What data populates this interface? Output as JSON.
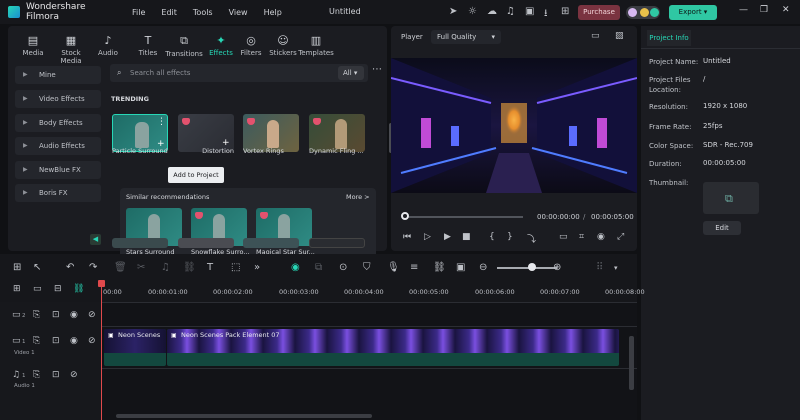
{
  "titlebar": {
    "app_name": "Wondershare Filmora",
    "menus": [
      "File",
      "Edit",
      "Tools",
      "View",
      "Help"
    ],
    "project_title": "Untitled",
    "purchase_label": "Purchase",
    "export_label": "Export"
  },
  "media_tabs": [
    {
      "label": "Media",
      "icon": "media-icon"
    },
    {
      "label": "Stock Media",
      "icon": "stock-media-icon"
    },
    {
      "label": "Audio",
      "icon": "audio-icon"
    },
    {
      "label": "Titles",
      "icon": "titles-icon"
    },
    {
      "label": "Transitions",
      "icon": "transitions-icon"
    },
    {
      "label": "Effects",
      "icon": "effects-icon",
      "active": true
    },
    {
      "label": "Filters",
      "icon": "filters-icon"
    },
    {
      "label": "Stickers",
      "icon": "stickers-icon"
    },
    {
      "label": "Templates",
      "icon": "templates-icon"
    }
  ],
  "categories": [
    "Mine",
    "Video Effects",
    "Body Effects",
    "Audio Effects",
    "NewBlue FX",
    "Boris FX"
  ],
  "search": {
    "placeholder": "Search all effects",
    "filter_value": "All"
  },
  "trending": {
    "heading": "TRENDING",
    "items": [
      "Particle Surround",
      "Distortion",
      "Vortex Rings",
      "Dynamic Fling ..."
    ]
  },
  "tooltip": "Add to Project",
  "recommendations": {
    "heading": "Similar recommendations",
    "more_label": "More >",
    "items": [
      "Stars Surround",
      "Snowflake Surro...",
      "Magical Star Sur..."
    ]
  },
  "player": {
    "label": "Player",
    "quality": "Full Quality",
    "current_time": "00:00:00:00",
    "total_time": "00:00:05:00"
  },
  "project_info": {
    "tab_label": "Project Info",
    "fields": [
      {
        "key": "Project Name:",
        "value": "Untitled"
      },
      {
        "key": "Project Files Location:",
        "value": "/"
      },
      {
        "key": "Resolution:",
        "value": "1920 x 1080"
      },
      {
        "key": "Frame Rate:",
        "value": "25fps"
      },
      {
        "key": "Color Space:",
        "value": "SDR - Rec.709"
      },
      {
        "key": "Duration:",
        "value": "00:00:05:00"
      },
      {
        "key": "Thumbnail:",
        "value": ""
      }
    ],
    "edit_label": "Edit"
  },
  "timeline": {
    "ruler": [
      "00:00",
      "00:00:01:00",
      "00:00:02:00",
      "00:00:03:00",
      "00:00:04:00",
      "00:00:05:00",
      "00:00:06:00",
      "00:00:07:00",
      "00:00:08:00"
    ],
    "tracks": [
      {
        "label": "2",
        "name": ""
      },
      {
        "label": "1",
        "name": "Video 1"
      },
      {
        "label": "1",
        "name": "Audio 1"
      }
    ],
    "clips": [
      {
        "label": "Neon Scenes"
      },
      {
        "label": "Neon Scenes Pack Element 07"
      }
    ]
  },
  "colors": {
    "accent": "#27d7b6",
    "purchase": "#7a3340",
    "playhead": "#e0494c",
    "clip": "#13483f"
  }
}
